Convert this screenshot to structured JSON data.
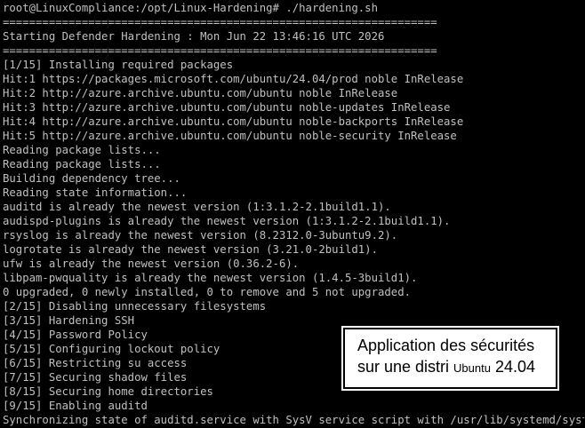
{
  "colors": {
    "background": "#000000",
    "terminal_text": "#c0c0c0",
    "overlay_background": "#ffffff",
    "overlay_text": "#000000"
  },
  "terminal": {
    "lines": [
      "root@LinuxCompliance:/opt/Linux-Hardening# ./hardening.sh",
      "==================================================================",
      "Starting Defender Hardening : Mon Jun 22 13:46:16 UTC 2026",
      "==================================================================",
      "[1/15] Installing required packages",
      "Hit:1 https://packages.microsoft.com/ubuntu/24.04/prod noble InRelease",
      "Hit:2 http://azure.archive.ubuntu.com/ubuntu noble InRelease",
      "Hit:3 http://azure.archive.ubuntu.com/ubuntu noble-updates InRelease",
      "Hit:4 http://azure.archive.ubuntu.com/ubuntu noble-backports InRelease",
      "Hit:5 http://azure.archive.ubuntu.com/ubuntu noble-security InRelease",
      "Reading package lists...",
      "Reading package lists...",
      "Building dependency tree...",
      "Reading state information...",
      "auditd is already the newest version (1:3.1.2-2.1build1.1).",
      "audispd-plugins is already the newest version (1:3.1.2-2.1build1.1).",
      "rsyslog is already the newest version (8.2312.0-3ubuntu9.2).",
      "logrotate is already the newest version (3.21.0-2build1).",
      "ufw is already the newest version (0.36.2-6).",
      "libpam-pwquality is already the newest version (1.4.5-3build1).",
      "0 upgraded, 0 newly installed, 0 to remove and 5 not upgraded.",
      "[2/15] Disabling unnecessary filesystems",
      "[3/15] Hardening SSH",
      "[4/15] Password Policy",
      "[5/15] Configuring lockout policy",
      "[6/15] Restricting su access",
      "[7/15] Securing shadow files",
      "[8/15] Securing home directories",
      "[9/15] Enabling auditd",
      "Synchronizing state of auditd.service with SysV service script with /usr/lib/systemd/systemd-sysv-install."
    ]
  },
  "overlay": {
    "line1": "Application des sécurités",
    "line2_prefix": "sur une distri ",
    "line2_small": "Ubuntu",
    "line2_suffix": " 24.04"
  }
}
